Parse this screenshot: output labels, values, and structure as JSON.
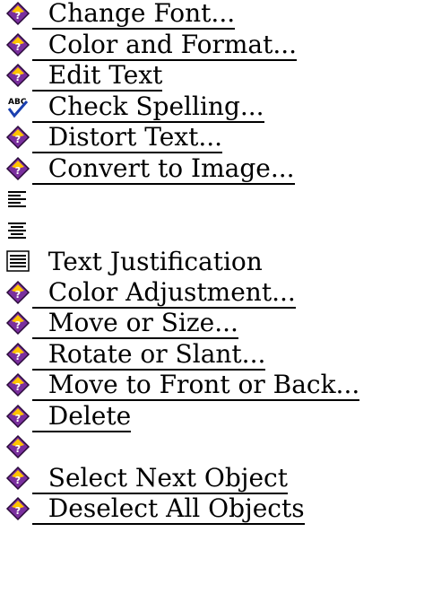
{
  "menu": {
    "items": [
      {
        "label": "  Change Font...",
        "icon": "diamond-icon",
        "link": true
      },
      {
        "label": "  Color and Format...",
        "icon": "diamond-icon",
        "link": true
      },
      {
        "label": "  Edit Text",
        "icon": "diamond-icon",
        "link": true
      },
      {
        "label": "  Check Spelling...",
        "icon": "spellcheck-icon",
        "link": true
      },
      {
        "label": "  Distort Text...",
        "icon": "diamond-icon",
        "link": true
      },
      {
        "label": "  Convert to Image...",
        "icon": "diamond-icon",
        "link": true
      },
      {
        "label": "",
        "icon": "align-left-icon",
        "link": false
      },
      {
        "label": "",
        "icon": "align-center-icon",
        "link": false
      },
      {
        "label": "  Text Justification",
        "icon": "justify-icon",
        "link": false
      },
      {
        "label": "  Color Adjustment...",
        "icon": "diamond-icon",
        "link": true
      },
      {
        "label": "  Move or Size...",
        "icon": "diamond-icon",
        "link": true
      },
      {
        "label": "  Rotate or Slant...",
        "icon": "diamond-icon",
        "link": true
      },
      {
        "label": "  Move to Front or Back...",
        "icon": "diamond-icon",
        "link": true
      },
      {
        "label": "  Delete",
        "icon": "diamond-icon",
        "link": true
      },
      {
        "label": "",
        "icon": "diamond-icon",
        "link": false
      },
      {
        "label": "  Select Next Object",
        "icon": "diamond-icon",
        "link": true
      },
      {
        "label": "  Deselect All Objects",
        "icon": "diamond-icon",
        "link": true
      }
    ]
  }
}
